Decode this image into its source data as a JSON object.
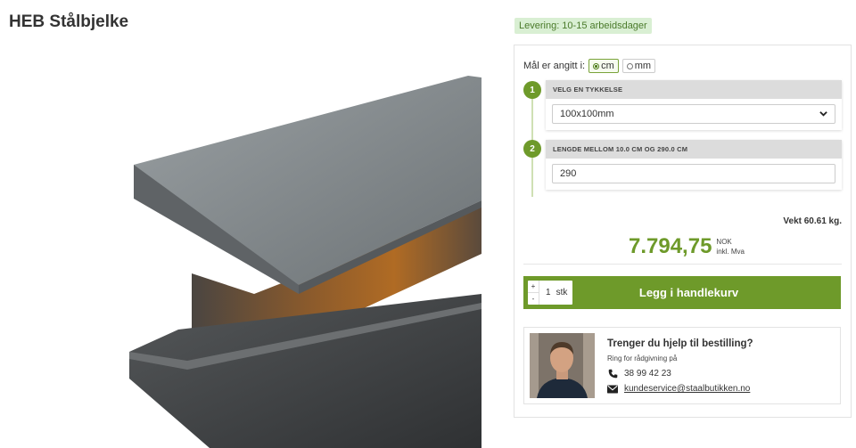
{
  "product": {
    "title": "HEB Stålbjelke"
  },
  "delivery": {
    "label": "Levering: 10-15 arbeidsdager"
  },
  "units": {
    "label": "Mål er angitt i:",
    "options": [
      "cm",
      "mm"
    ],
    "selected": "cm"
  },
  "steps": [
    {
      "number": "1",
      "title": "VELG EN TYKKELSE",
      "value": "100x100mm"
    },
    {
      "number": "2",
      "title": "LENGDE MELLOM 10.0 CM OG 290.0 CM",
      "value": "290"
    }
  ],
  "weight": "Vekt 60.61 kg.",
  "price": {
    "amount": "7.794,75",
    "currency": "NOK",
    "vat": "inkl. Mva"
  },
  "cart": {
    "plus": "+",
    "minus": "-",
    "quantity": "1",
    "unit": "stk",
    "button_label": "Legg i handlekurv"
  },
  "help": {
    "title": "Trenger du hjelp til bestilling?",
    "subtitle": "Ring for rådgivning på",
    "phone": "38 99 42 23",
    "email": "kundeservice@staalbutikken.no"
  },
  "colors": {
    "accent": "#6e9a2a",
    "badge_bg": "#d9efd3"
  },
  "icons": {
    "phone": "phone-icon",
    "email": "envelope-icon",
    "select": "chevron-down-icon"
  }
}
